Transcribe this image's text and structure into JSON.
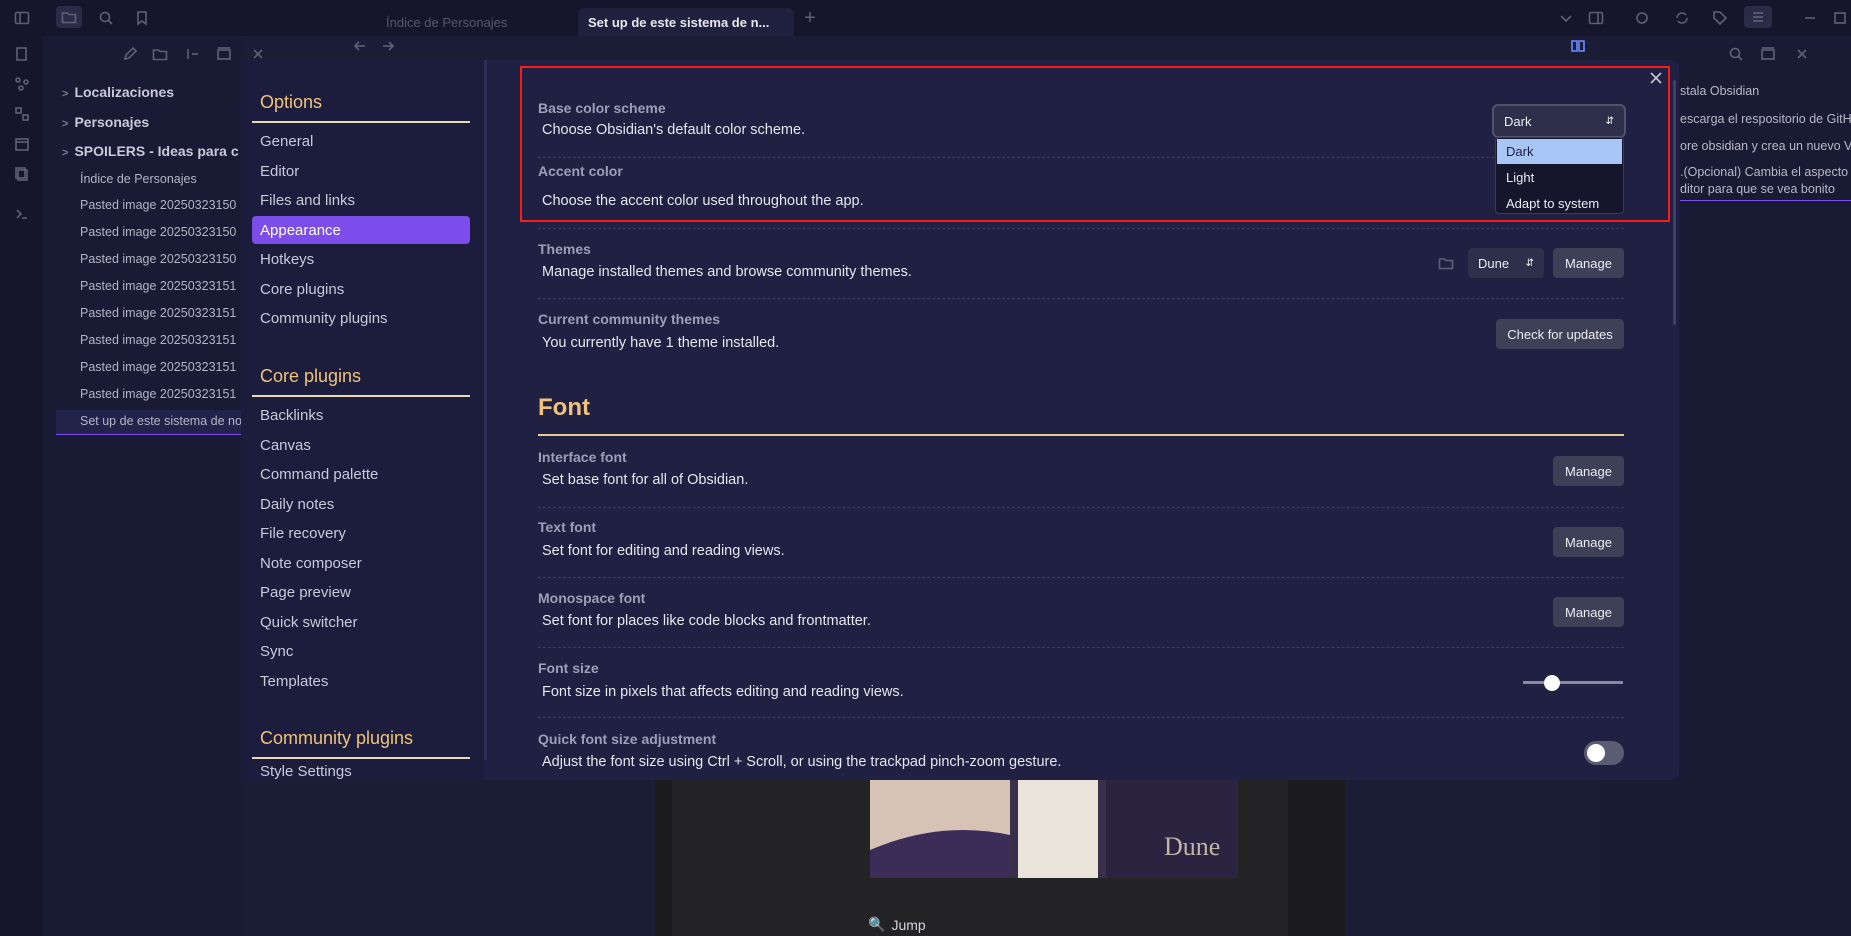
{
  "titlebar": {
    "tabs": [
      {
        "label": "Índice de Personajes"
      },
      {
        "label": "Set up de este sistema de n..."
      }
    ]
  },
  "sidebar": {
    "folders": [
      "Localizaciones",
      "Personajes",
      "SPOILERS - Ideas para c"
    ],
    "files": [
      "Índice de Personajes",
      "Pasted image 20250323150",
      "Pasted image 20250323150",
      "Pasted image 20250323150",
      "Pasted image 20250323151",
      "Pasted image 20250323151",
      "Pasted image 20250323151",
      "Pasted image 20250323151",
      "Pasted image 20250323151",
      "Set up de este sistema de no"
    ]
  },
  "right_panel": {
    "items": [
      "stala Obsidian",
      "escarga el respositorio de GitH",
      "ore obsidian y crea un nuevo V",
      ".(Opcional) Cambia el aspecto",
      "ditor para que se vea bonito"
    ]
  },
  "backdrop": {
    "dune_text": "Dune",
    "jump_text": "Jump"
  },
  "settings": {
    "nav": {
      "options_heading": "Options",
      "options": [
        "General",
        "Editor",
        "Files and links",
        "Appearance",
        "Hotkeys",
        "Core plugins",
        "Community plugins"
      ],
      "selected": "Appearance",
      "core_heading": "Core plugins",
      "core": [
        "Backlinks",
        "Canvas",
        "Command palette",
        "Daily notes",
        "File recovery",
        "Note composer",
        "Page preview",
        "Quick switcher",
        "Sync",
        "Templates"
      ],
      "community_heading": "Community plugins",
      "community": [
        "Style Settings"
      ]
    },
    "base_color": {
      "name": "Base color scheme",
      "desc": "Choose Obsidian's default color scheme.",
      "value": "Dark",
      "options": [
        "Dark",
        "Light",
        "Adapt to system"
      ]
    },
    "accent": {
      "name": "Accent color",
      "desc": "Choose the accent color used throughout the app."
    },
    "themes": {
      "name": "Themes",
      "desc": "Manage installed themes and browse community themes.",
      "value": "Dune",
      "manage": "Manage"
    },
    "community_themes": {
      "name": "Current community themes",
      "desc": "You currently have 1 theme installed.",
      "button": "Check for updates"
    },
    "font_heading": "Font",
    "interface_font": {
      "name": "Interface font",
      "desc": "Set base font for all of Obsidian.",
      "button": "Manage"
    },
    "text_font": {
      "name": "Text font",
      "desc": "Set font for editing and reading views.",
      "button": "Manage"
    },
    "mono_font": {
      "name": "Monospace font",
      "desc": "Set font for places like code blocks and frontmatter.",
      "button": "Manage"
    },
    "font_size": {
      "name": "Font size",
      "desc": "Font size in pixels that affects editing and reading views.",
      "level": 0.29
    },
    "quick_font": {
      "name": "Quick font size adjustment",
      "desc": "Adjust the font size using Ctrl + Scroll, or using the trackpad pinch-zoom gesture.",
      "enabled": false
    }
  },
  "colors": {
    "accent": "#7c4dea",
    "heading": "#f0c27a",
    "highlight_box": "#ff1a1a"
  }
}
